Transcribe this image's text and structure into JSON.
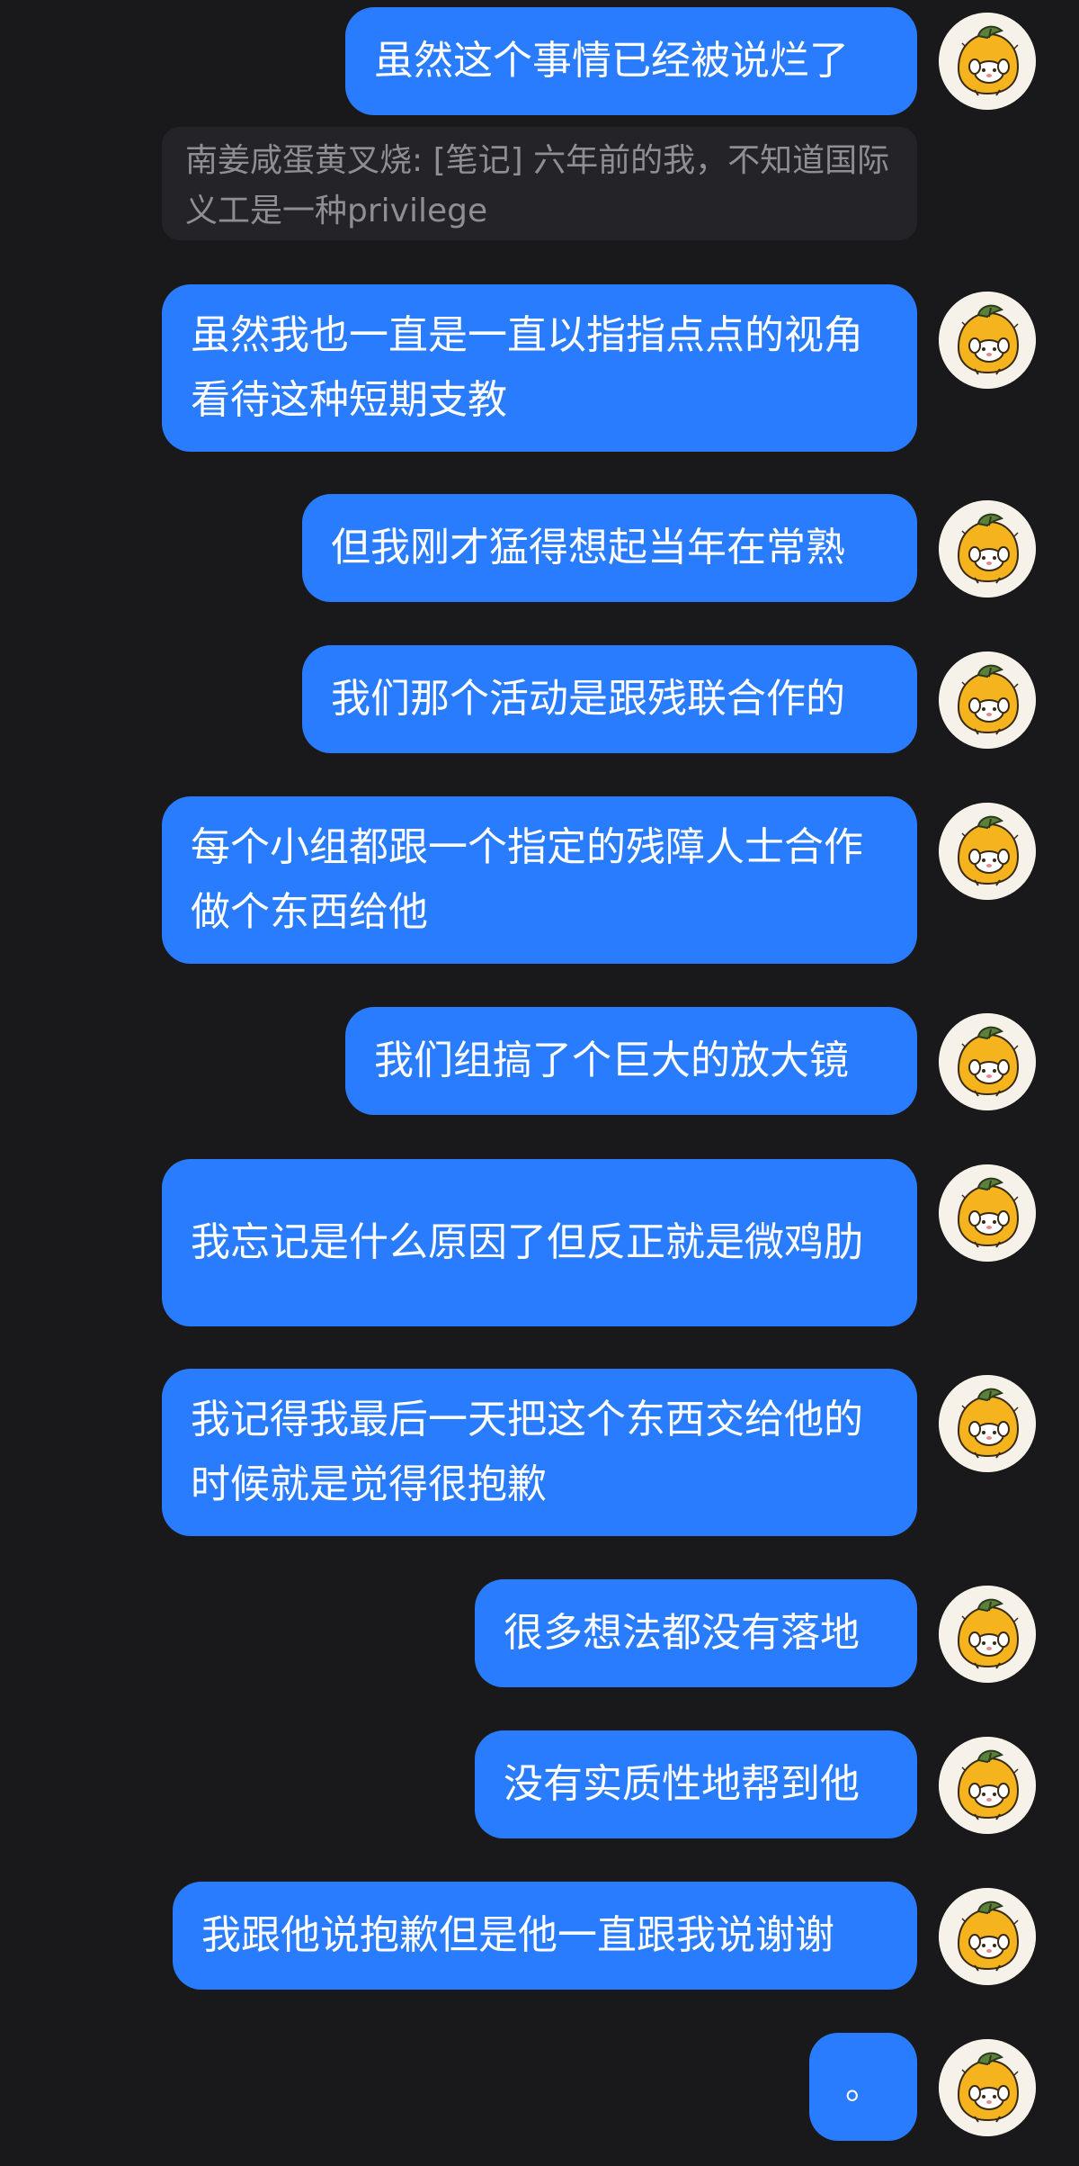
{
  "quote": {
    "sender": "南姜咸蛋黄叉烧",
    "text": "[笔记] 六年前的我，不知道国际义工是一种privilege"
  },
  "messages": [
    {
      "text": "虽然这个事情已经被说烂了"
    },
    {
      "text": "虽然我也一直是一直以指指点点的视角看待这种短期支教"
    },
    {
      "text": "但我刚才猛得想起当年在常熟"
    },
    {
      "text": "我们那个活动是跟残联合作的"
    },
    {
      "text": "每个小组都跟一个指定的残障人士合作做个东西给他"
    },
    {
      "text": "我们组搞了个巨大的放大镜"
    },
    {
      "text": "我忘记是什么原因了但反正就是微鸡肋"
    },
    {
      "text": "我记得我最后一天把这个东西交给他的时候就是觉得很抱歉"
    },
    {
      "text": "很多想法都没有落地"
    },
    {
      "text": "没有实质性地帮到他"
    },
    {
      "text": "我跟他说抱歉但是他一直跟我说谢谢"
    },
    {
      "text": "。"
    }
  ],
  "colors": {
    "background": "#19191c",
    "bubble": "#2a7cff",
    "quote_bg": "#242428",
    "quote_text": "#8e8e93"
  },
  "avatar_icon": "orange-puppy-avatar-icon"
}
